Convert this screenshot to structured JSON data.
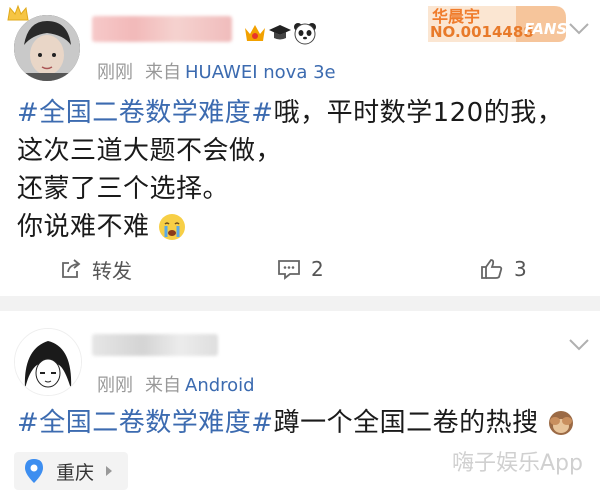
{
  "post1": {
    "time": "刚刚",
    "from_label": "来自",
    "source": "HUAWEI nova 3e",
    "fans_badge": {
      "title": "华晨宇",
      "number": "NO.0014488",
      "tag": "FANS"
    },
    "topic": "#全国二卷数学难度#",
    "lines": [
      "哦，平时数学120的我，",
      "这次三道大题不会做，",
      "还蒙了三个选择。",
      "你说难不难"
    ],
    "actions": {
      "repost": "转发",
      "comment": "2",
      "like": "3"
    }
  },
  "post2": {
    "time": "刚刚",
    "from_label": "来自",
    "source": "Android",
    "topic": "#全国二卷数学难度#",
    "text": "蹲一个全国二卷的热搜",
    "location": "重庆"
  },
  "watermark": "嗨子娱乐App",
  "colors": {
    "link": "#3c6bb0",
    "divider": "#f2f2f2",
    "badge_orange": "#f07c2c"
  }
}
